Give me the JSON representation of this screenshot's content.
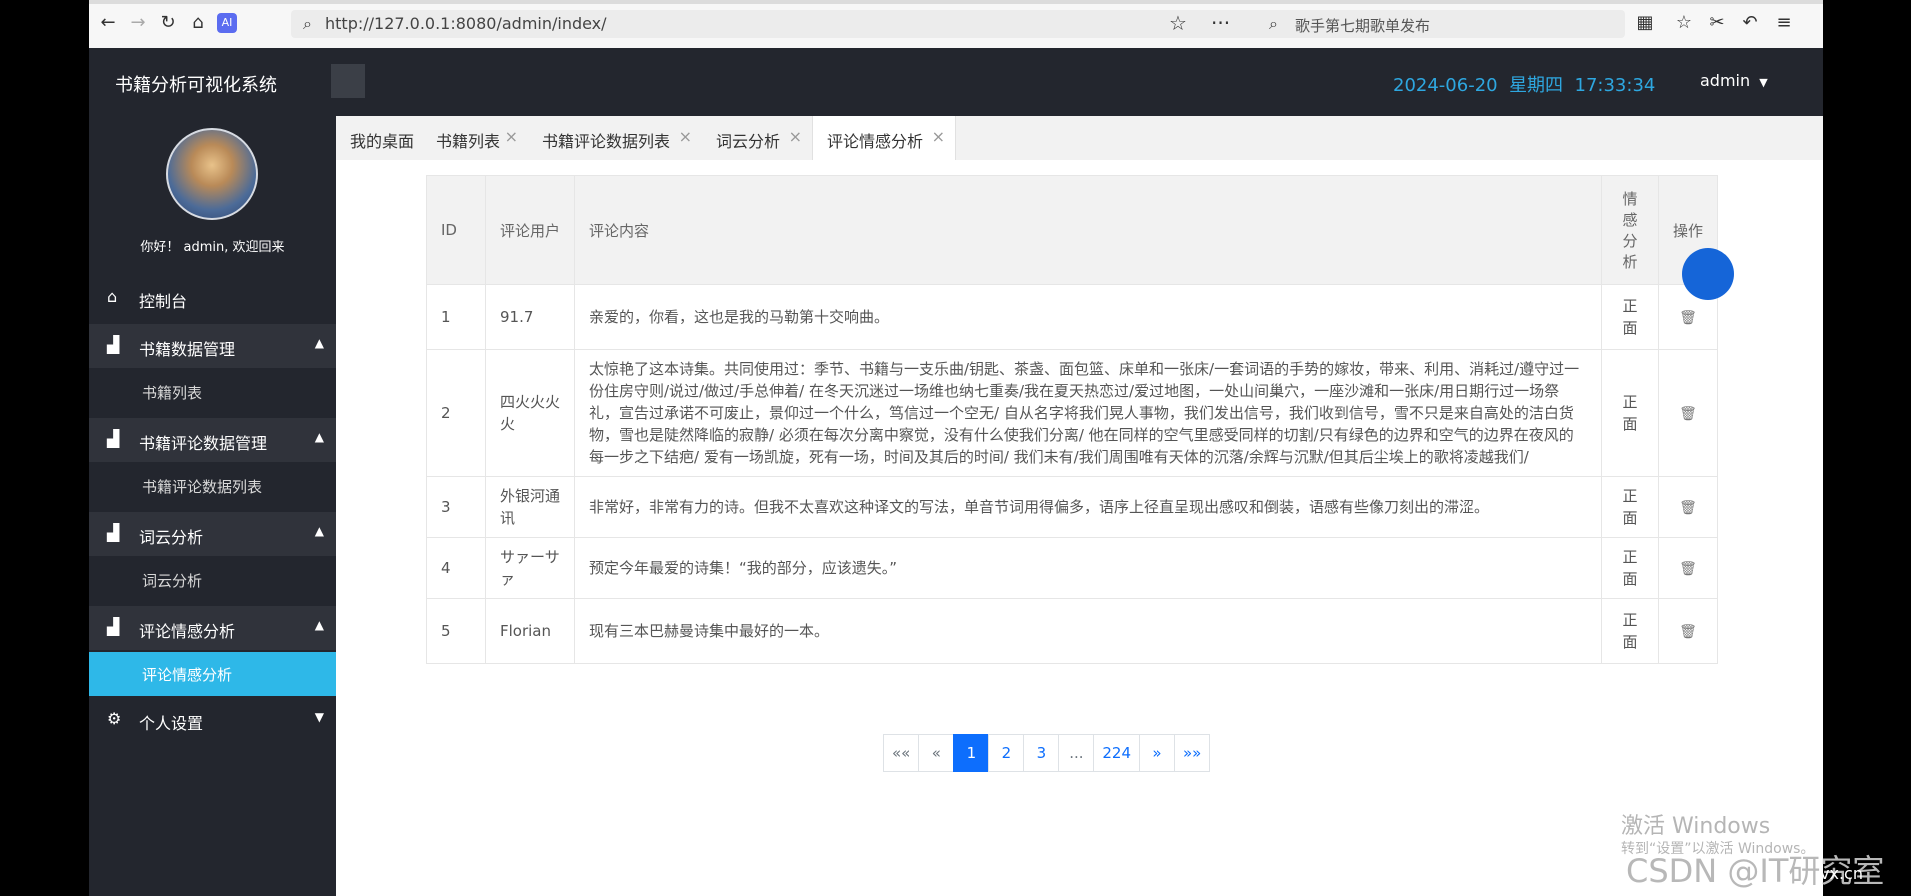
{
  "browser": {
    "url": "http://127.0.0.1:8080/admin/index/",
    "search_placeholder": "歌手第七期歌单发布"
  },
  "header": {
    "system_title": "书籍分析可视化系统",
    "date": "2024-06-20",
    "weekday": "星期四",
    "time": "17:33:34",
    "user": "admin"
  },
  "sidebar": {
    "welcome": "你好！ admin, 欢迎回来",
    "dashboard": "控制台",
    "groups": [
      {
        "label": "书籍数据管理",
        "sub": "书籍列表"
      },
      {
        "label": "书籍评论数据管理",
        "sub": "书籍评论数据列表"
      },
      {
        "label": "词云分析",
        "sub": "词云分析"
      },
      {
        "label": "评论情感分析",
        "sub": "评论情感分析"
      }
    ],
    "settings": "个人设置"
  },
  "tabs": [
    "我的桌面",
    "书籍列表",
    "书籍评论数据列表",
    "词云分析",
    "评论情感分析"
  ],
  "table": {
    "headers": [
      "ID",
      "评论用户",
      "评论内容",
      "情感分析",
      "操作"
    ],
    "rows": [
      {
        "id": "1",
        "user": "91.7",
        "content": "亲爱的，你看，这也是我的马勒第十交响曲。",
        "sentiment": "正面"
      },
      {
        "id": "2",
        "user": "四火火火火",
        "content": "太惊艳了这本诗集。共同使用过：季节、书籍与一支乐曲/钥匙、茶盏、面包篮、床单和一张床/一套词语的手势的嫁妆，带来、利用、消耗过/遵守过一份住房守则/说过/做过/手总伸着/ 在冬天沉迷过一场维也纳七重奏/我在夏天热恋过/爱过地图，一处山间巢穴，一座沙滩和一张床/用日期行过一场祭礼，宣告过承诺不可废止，景仰过一个什么，笃信过一个空无/ 自从名字将我们晃人事物，我们发出信号，我们收到信号，雪不只是来自高处的洁白货物，雪也是陡然降临的寂静/ 必须在每次分离中察觉，没有什么使我们分离/ 他在同样的空气里感受同样的切割/只有绿色的边界和空气的边界在夜风的每一步之下结疤/ 爱有一场凯旋，死有一场，时间及其后的时间/ 我们未有/我们周围唯有天体的沉落/余辉与沉默/但其后尘埃上的歌将凌越我们/",
        "sentiment": "正面"
      },
      {
        "id": "3",
        "user": "外银河通讯",
        "content": "非常好，非常有力的诗。但我不太喜欢这种译文的写法，单音节词用得偏多，语序上径直呈现出感叹和倒装，语感有些像刀刻出的滞涩。",
        "sentiment": "正面"
      },
      {
        "id": "4",
        "user": "サァーサァ",
        "content": "预定今年最爱的诗集！“我的部分，应该遗失。”",
        "sentiment": "正面"
      },
      {
        "id": "5",
        "user": "Florian",
        "content": "现有三本巴赫曼诗集中最好的一本。",
        "sentiment": "正面"
      }
    ]
  },
  "pagination": [
    "««",
    "«",
    "1",
    "2",
    "3",
    "...",
    "224",
    "»",
    "»»"
  ],
  "overlay": {
    "watermark_title": "激活 Windows",
    "watermark_sub": "转到“设置”以激活 Windows。",
    "csdn": "CSDN @IT研究室",
    "wechat": "vx.cn"
  },
  "colors": {
    "accent": "#2eb8e8",
    "header_bg": "#23262e",
    "date_color": "#2ea7e0",
    "page_active": "#0d6efd"
  }
}
